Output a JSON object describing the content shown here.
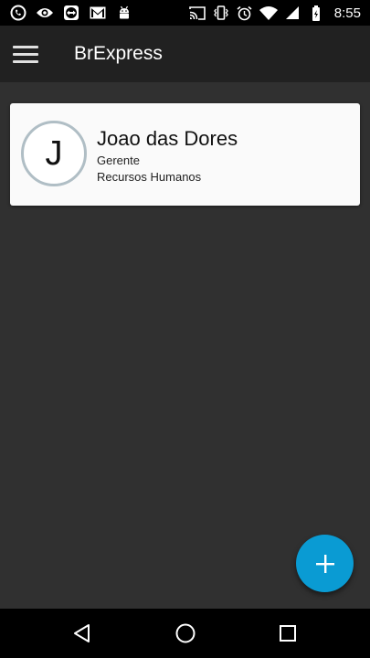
{
  "status_bar": {
    "time": "8:55",
    "left_icons": [
      "whatsapp-icon",
      "eye-icon",
      "teamviewer-icon",
      "gmail-icon",
      "android-icon"
    ],
    "right_icons": [
      "cast-icon",
      "vibrate-icon",
      "alarm-icon",
      "wifi-icon",
      "signal-icon",
      "battery-icon"
    ]
  },
  "app_bar": {
    "title": "BrExpress",
    "menu_icon": "hamburger-menu-icon"
  },
  "employees": [
    {
      "initial": "J",
      "name": "Joao das Dores",
      "role": "Gerente",
      "department": "Recursos Humanos"
    }
  ],
  "fab": {
    "icon": "plus-icon",
    "color": "#0a9bd3"
  },
  "nav_bar": {
    "buttons": [
      "back-icon",
      "home-icon",
      "recents-icon"
    ]
  },
  "colors": {
    "background": "#303030",
    "app_bar": "#212121",
    "card": "#fafafa",
    "accent": "#0a9bd3"
  }
}
